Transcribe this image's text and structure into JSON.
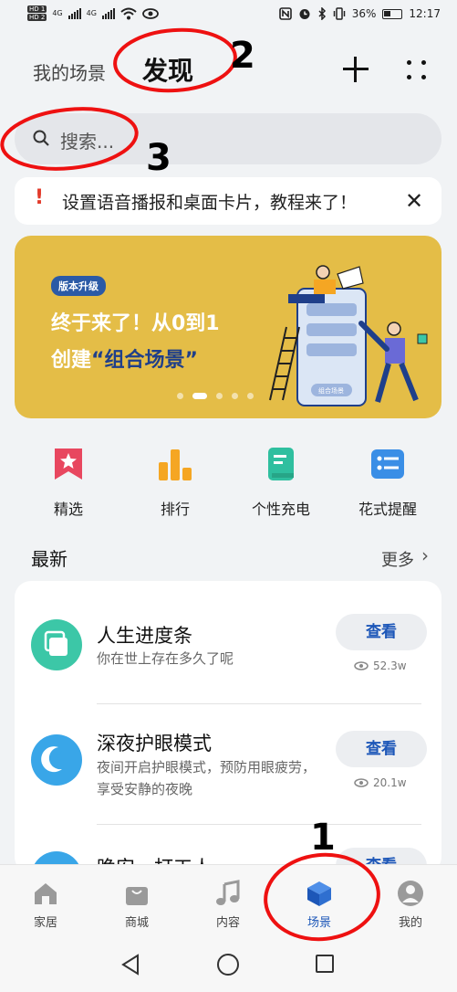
{
  "status_bar": {
    "hd1": "HD 1",
    "hd2": "HD 2",
    "net1": "4G",
    "net2": "4G",
    "battery": "36%",
    "time": "12:17"
  },
  "header": {
    "tab_my_scene": "我的场景",
    "tab_discover": "发现"
  },
  "search": {
    "placeholder": "搜索..."
  },
  "notice": {
    "text": "设置语音播报和桌面卡片，教程来了！",
    "icon": "exclamation-icon"
  },
  "banner": {
    "badge": "版本升级",
    "line1": "终于来了！从0到1",
    "line2_prefix": "创建",
    "line2_highlight": "“组合场景”",
    "mini_button": "组合场景",
    "active_slide": 2,
    "slide_count": 5
  },
  "categories": [
    {
      "label": "精选",
      "icon": "bookmark-star-icon",
      "color": "#e8475f"
    },
    {
      "label": "排行",
      "icon": "bar-chart-icon",
      "color": "#f5a623"
    },
    {
      "label": "个性充电",
      "icon": "book-icon",
      "color": "#2fbf9f"
    },
    {
      "label": "花式提醒",
      "icon": "list-icon",
      "color": "#3a8ee6"
    }
  ],
  "latest": {
    "title": "最新",
    "more": "更多",
    "items": [
      {
        "title": "人生进度条",
        "subtitle": "你在世上存在多久了呢",
        "button": "查看",
        "views": "52.3w",
        "icon": "cards-icon",
        "color": "#3cc7a7"
      },
      {
        "title": "深夜护眼模式",
        "subtitle": "夜间开启护眼模式，预防用眼疲劳，享受安静的夜晚",
        "button": "查看",
        "views": "20.1w",
        "icon": "moon-sleep-icon",
        "color": "#39a6e8"
      },
      {
        "title": "晚安，打工人",
        "button": "查看",
        "icon": "partial-icon",
        "color": "#39a6e8"
      }
    ]
  },
  "bottom_nav": [
    {
      "label": "家居",
      "icon": "home-icon"
    },
    {
      "label": "商城",
      "icon": "shopping-bag-icon"
    },
    {
      "label": "内容",
      "icon": "music-note-icon"
    },
    {
      "label": "场景",
      "icon": "cube-icon",
      "active": true
    },
    {
      "label": "我的",
      "icon": "profile-icon"
    }
  ],
  "annotations": [
    "1",
    "2",
    "3"
  ],
  "colors": {
    "accent": "#1d57b8",
    "banner": "#e4bd47",
    "annotation": "#e11111"
  }
}
